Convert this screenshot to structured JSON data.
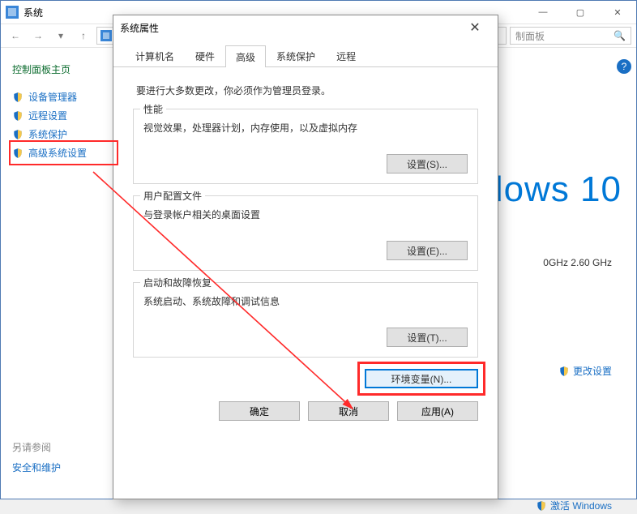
{
  "cp": {
    "title": "系统",
    "breadcrumb_tail": "制面板",
    "search_placeholder": "",
    "sidebar_home": "控制面板主页",
    "sidebar": [
      {
        "label": "设备管理器"
      },
      {
        "label": "远程设置"
      },
      {
        "label": "系统保护"
      },
      {
        "label": "高级系统设置"
      }
    ],
    "brand": "dows 10",
    "cpu": "0GHz   2.60 GHz",
    "change_settings": "更改设置",
    "activate": "激活 Windows",
    "see_also_hdr": "另请参阅",
    "see_also_link": "安全和维护",
    "winbtns": {
      "min": "—",
      "max": "▢",
      "close": "✕"
    }
  },
  "dlg": {
    "title": "系统属性",
    "close": "✕",
    "tabs": [
      "计算机名",
      "硬件",
      "高级",
      "系统保护",
      "远程"
    ],
    "active_tab": 2,
    "note": "要进行大多数更改，你必须作为管理员登录。",
    "groups": [
      {
        "title": "性能",
        "desc": "视觉效果，处理器计划，内存使用，以及虚拟内存",
        "btn": "设置(S)..."
      },
      {
        "title": "用户配置文件",
        "desc": "与登录帐户相关的桌面设置",
        "btn": "设置(E)..."
      },
      {
        "title": "启动和故障恢复",
        "desc": "系统启动、系统故障和调试信息",
        "btn": "设置(T)..."
      }
    ],
    "env_btn": "环境变量(N)...",
    "footer": {
      "ok": "确定",
      "cancel": "取消",
      "apply": "应用(A)"
    }
  }
}
